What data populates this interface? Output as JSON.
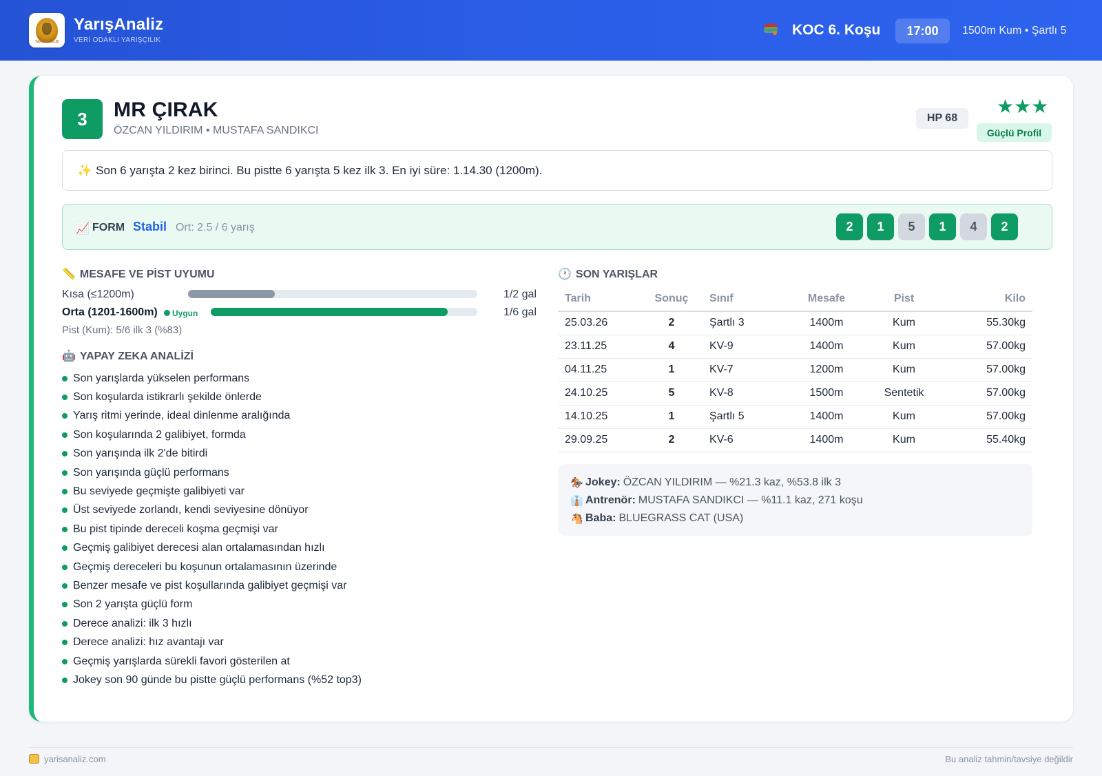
{
  "header": {
    "brand": "YarışAnaliz",
    "tagline": "VERİ ODAKLI YARIŞÇILIK",
    "logo_text": "YARIŞ ANALİZ",
    "race": "KOC 6. Koşu",
    "time": "17:00",
    "race_info": "1500m Kum • Şartlı 5"
  },
  "horse": {
    "number": "3",
    "name": "MR ÇIRAK",
    "people": "ÖZCAN YILDIRIM • MUSTAFA SANDIKCI",
    "hp": "HP 68",
    "stars": "★★★",
    "star_rating": 3,
    "profile": "Güçlü Profil"
  },
  "summary": {
    "icon": "✨",
    "text": "Son 6 yarışta 2 kez birinci. Bu pistte 6 yarışta 5 kez ilk 3. En iyi süre: 1.14.30 (1200m)."
  },
  "form": {
    "icon": "📈",
    "label": "FORM",
    "state": "Stabil",
    "avg": "Ort: 2.5 / 6 yarış",
    "results": [
      "2",
      "1",
      "5",
      "1",
      "4",
      "2"
    ]
  },
  "distance": {
    "icon": "📏",
    "title": "MESAFE VE PİST UYUMU",
    "rows": [
      {
        "label": "Kısa (≤1200m)",
        "value": "1/2 gal",
        "ratio": 0.3
      },
      {
        "label": "Orta (1201-1600m)",
        "value": "1/6 gal",
        "ratio": 0.89,
        "tag": "Uygun"
      }
    ],
    "pist": "Pist (Kum): 5/6 ilk 3 (%83)"
  },
  "ai": {
    "icon": "🤖",
    "title": "YAPAY ZEKA ANALİZİ",
    "items": [
      "Son yarışlarda yükselen performans",
      "Son koşularda istikrarlı şekilde önlerde",
      "Yarış ritmi yerinde, ideal dinlenme aralığında",
      "Son koşularında 2 galibiyet, formda",
      "Son yarışında ilk 2'de bitirdi",
      "Son yarışında güçlü performans",
      "Bu seviyede geçmişte galibiyeti var",
      "Üst seviyede zorlandı, kendi seviyesine dönüyor",
      "Bu pist tipinde dereceli koşma geçmişi var",
      "Geçmiş galibiyet derecesi alan ortalamasından hızlı",
      "Geçmiş dereceleri bu koşunun ortalamasının üzerinde",
      "Benzer mesafe ve pist koşullarında galibiyet geçmişi var",
      "Son 2 yarışta güçlü form",
      "Derece analizi: ilk 3 hızlı",
      "Derece analizi: hız avantajı var",
      "Geçmiş yarışlarda sürekli favori gösterilen at",
      "Jokey son 90 günde bu pistte güçlü performans (%52 top3)"
    ]
  },
  "races": {
    "icon": "🕐",
    "title": "SON YARIŞLAR",
    "columns": [
      "Tarih",
      "Sonuç",
      "Sınıf",
      "Mesafe",
      "Pist",
      "Kilo"
    ],
    "rows": [
      {
        "date": "25.03.26",
        "result": "2",
        "color": "orange",
        "class": "Şartlı 3",
        "distance": "1400m",
        "track": "Kum",
        "weight": "55.30kg"
      },
      {
        "date": "23.11.25",
        "result": "4",
        "color": "grey",
        "class": "KV-9",
        "distance": "1400m",
        "track": "Kum",
        "weight": "57.00kg"
      },
      {
        "date": "04.11.25",
        "result": "1",
        "color": "green",
        "class": "KV-7",
        "distance": "1200m",
        "track": "Kum",
        "weight": "57.00kg"
      },
      {
        "date": "24.10.25",
        "result": "5",
        "color": "grey",
        "class": "KV-8",
        "distance": "1500m",
        "track": "Sentetik",
        "weight": "57.00kg"
      },
      {
        "date": "14.10.25",
        "result": "1",
        "color": "green",
        "class": "Şartlı 5",
        "distance": "1400m",
        "track": "Kum",
        "weight": "57.00kg"
      },
      {
        "date": "29.09.25",
        "result": "2",
        "color": "orange",
        "class": "KV-6",
        "distance": "1400m",
        "track": "Kum",
        "weight": "55.40kg"
      }
    ]
  },
  "info": {
    "jockey_icon": "🏇",
    "jockey_label": "Jokey:",
    "jockey": "ÖZCAN YILDIRIM — %21.3 kaz, %53.8 ilk 3",
    "trainer_icon": "👔",
    "trainer_label": "Antrenör:",
    "trainer": "MUSTAFA SANDIKCI — %11.1 kaz, 271 koşu",
    "sire_icon": "🐴",
    "sire_label": "Baba:",
    "sire": "BLUEGRASS CAT (USA)"
  },
  "footer": {
    "site": "yarisanaliz.com",
    "note": "Bu analiz tahmin/tavsiye değildir"
  },
  "colors": {
    "header": "#2b5ee8",
    "accent_green": "#0f9b64",
    "accent_blue": "#2563eb",
    "result_orange": "#e07b00"
  }
}
